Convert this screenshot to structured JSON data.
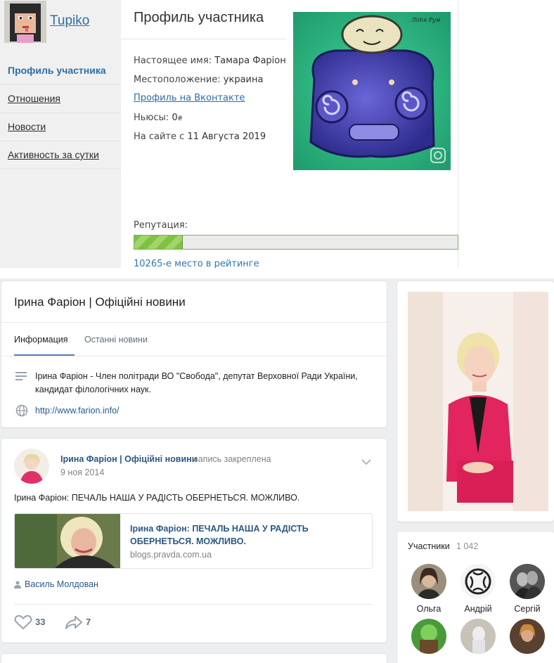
{
  "forum": {
    "username": "Tupiko",
    "menu": [
      {
        "label": "Профиль участника",
        "active": true
      },
      {
        "label": "Отношения",
        "active": false
      },
      {
        "label": "Новости",
        "active": false
      },
      {
        "label": "Активность за сутки",
        "active": false
      }
    ],
    "profile_title": "Профиль участника",
    "real_name_label": "Настоящее имя:",
    "real_name": "Тамара Фаріон",
    "location_label": "Местоположение:",
    "location": "украина",
    "vk_link": "Профиль на Вконтакте",
    "news_label": "Ньюсы:",
    "news_value": "0",
    "news_currency": "₴",
    "joined_label": "На сайте с",
    "joined_date": "11 Августа 2019",
    "reputation_label": "Репутация:",
    "reputation_fraction": 0.15,
    "rank_text": "10265-е место в рейтинге"
  },
  "vk": {
    "group_title": "Ірина Фаріон | Офіційні новини",
    "tabs": [
      "Информация",
      "Останні новини"
    ],
    "description": "Ірина Фаріон - Член політради ВО \"Свобода\", депутат Верховної Ради України, кандидат філологічних наук.",
    "website": "http://www.farion.info/",
    "post": {
      "author": "Ірина Фаріон | Офіційні новини",
      "pinned": "запись закреплена",
      "date": "9 ноя 2014",
      "text": "Ірина Фаріон: ПЕЧАЛЬ НАША У РАДІСТЬ ОБЕРНЕТЬСЯ. МОЖЛИВО.",
      "link_title": "Ірина Фаріон: ПЕЧАЛЬ НАША У РАДІСТЬ ОБЕРНЕТЬСЯ. МОЖЛИВО.",
      "link_domain": "blogs.pravda.com.ua",
      "signer": "Василь Молдован",
      "likes": "33",
      "shares": "7"
    },
    "members_title": "Участники",
    "members_count": "1 042",
    "members": [
      "Ольга",
      "Андрій",
      "Сергій",
      "",
      "",
      ""
    ]
  },
  "colors": {
    "link_blue": "#2a5885",
    "forum_blue": "#2a6fa8",
    "rep_green": "#7fc241",
    "vk_bg": "#edeef0"
  }
}
